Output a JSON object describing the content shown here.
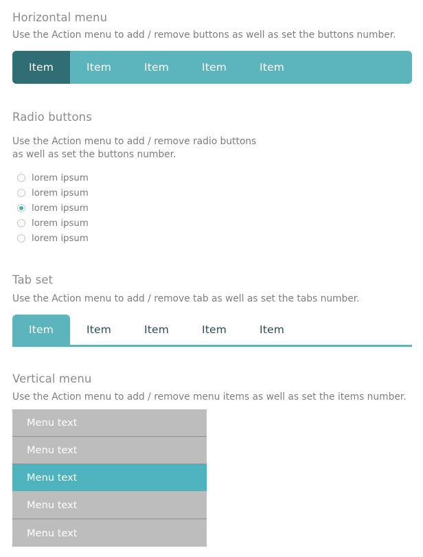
{
  "sections": {
    "horizontal_menu": {
      "title": "Horizontal menu",
      "description": "Use the Action menu to add / remove buttons as well as set the buttons number.",
      "items": [
        {
          "label": "Item",
          "active": true
        },
        {
          "label": "Item",
          "active": false
        },
        {
          "label": "Item",
          "active": false
        },
        {
          "label": "Item",
          "active": false
        },
        {
          "label": "Item",
          "active": false
        }
      ],
      "colors": {
        "bar": "#5cb4bd",
        "active": "#2f6e72",
        "text": "#ffffff"
      }
    },
    "radio_buttons": {
      "title": "Radio buttons",
      "description": "Use the Action menu to add / remove radio buttons\nas well as set the buttons number.",
      "options": [
        {
          "label": "lorem ipsum",
          "checked": false
        },
        {
          "label": "lorem ipsum",
          "checked": false
        },
        {
          "label": "lorem ipsum",
          "checked": true
        },
        {
          "label": "lorem ipsum",
          "checked": false
        },
        {
          "label": "lorem ipsum",
          "checked": false
        }
      ],
      "colors": {
        "dot": "#44b0bb",
        "ring": "#c8c8c8",
        "label": "#7a7a7a"
      }
    },
    "tab_set": {
      "title": "Tab set",
      "description": "Use the Action menu to add / remove tab as well as set the tabs number.",
      "tabs": [
        {
          "label": "Item",
          "active": true
        },
        {
          "label": "Item",
          "active": false
        },
        {
          "label": "Item",
          "active": false
        },
        {
          "label": "Item",
          "active": false
        },
        {
          "label": "Item",
          "active": false
        }
      ],
      "colors": {
        "active": "#5cb4bd",
        "inactive_text": "#2b4b54",
        "underline": "#5cb4bd"
      }
    },
    "vertical_menu": {
      "title": "Vertical menu",
      "description": "Use the Action menu to add / remove menu items as well as set the items number.",
      "items": [
        {
          "label": "Menu text",
          "active": false
        },
        {
          "label": "Menu text",
          "active": false
        },
        {
          "label": "Menu text",
          "active": true
        },
        {
          "label": "Menu text",
          "active": false
        },
        {
          "label": "Menu text",
          "active": false
        }
      ],
      "colors": {
        "item": "#bdbdbd",
        "active": "#4fb3bd",
        "separator": "#8e8e8e",
        "text": "#ffffff"
      }
    }
  }
}
